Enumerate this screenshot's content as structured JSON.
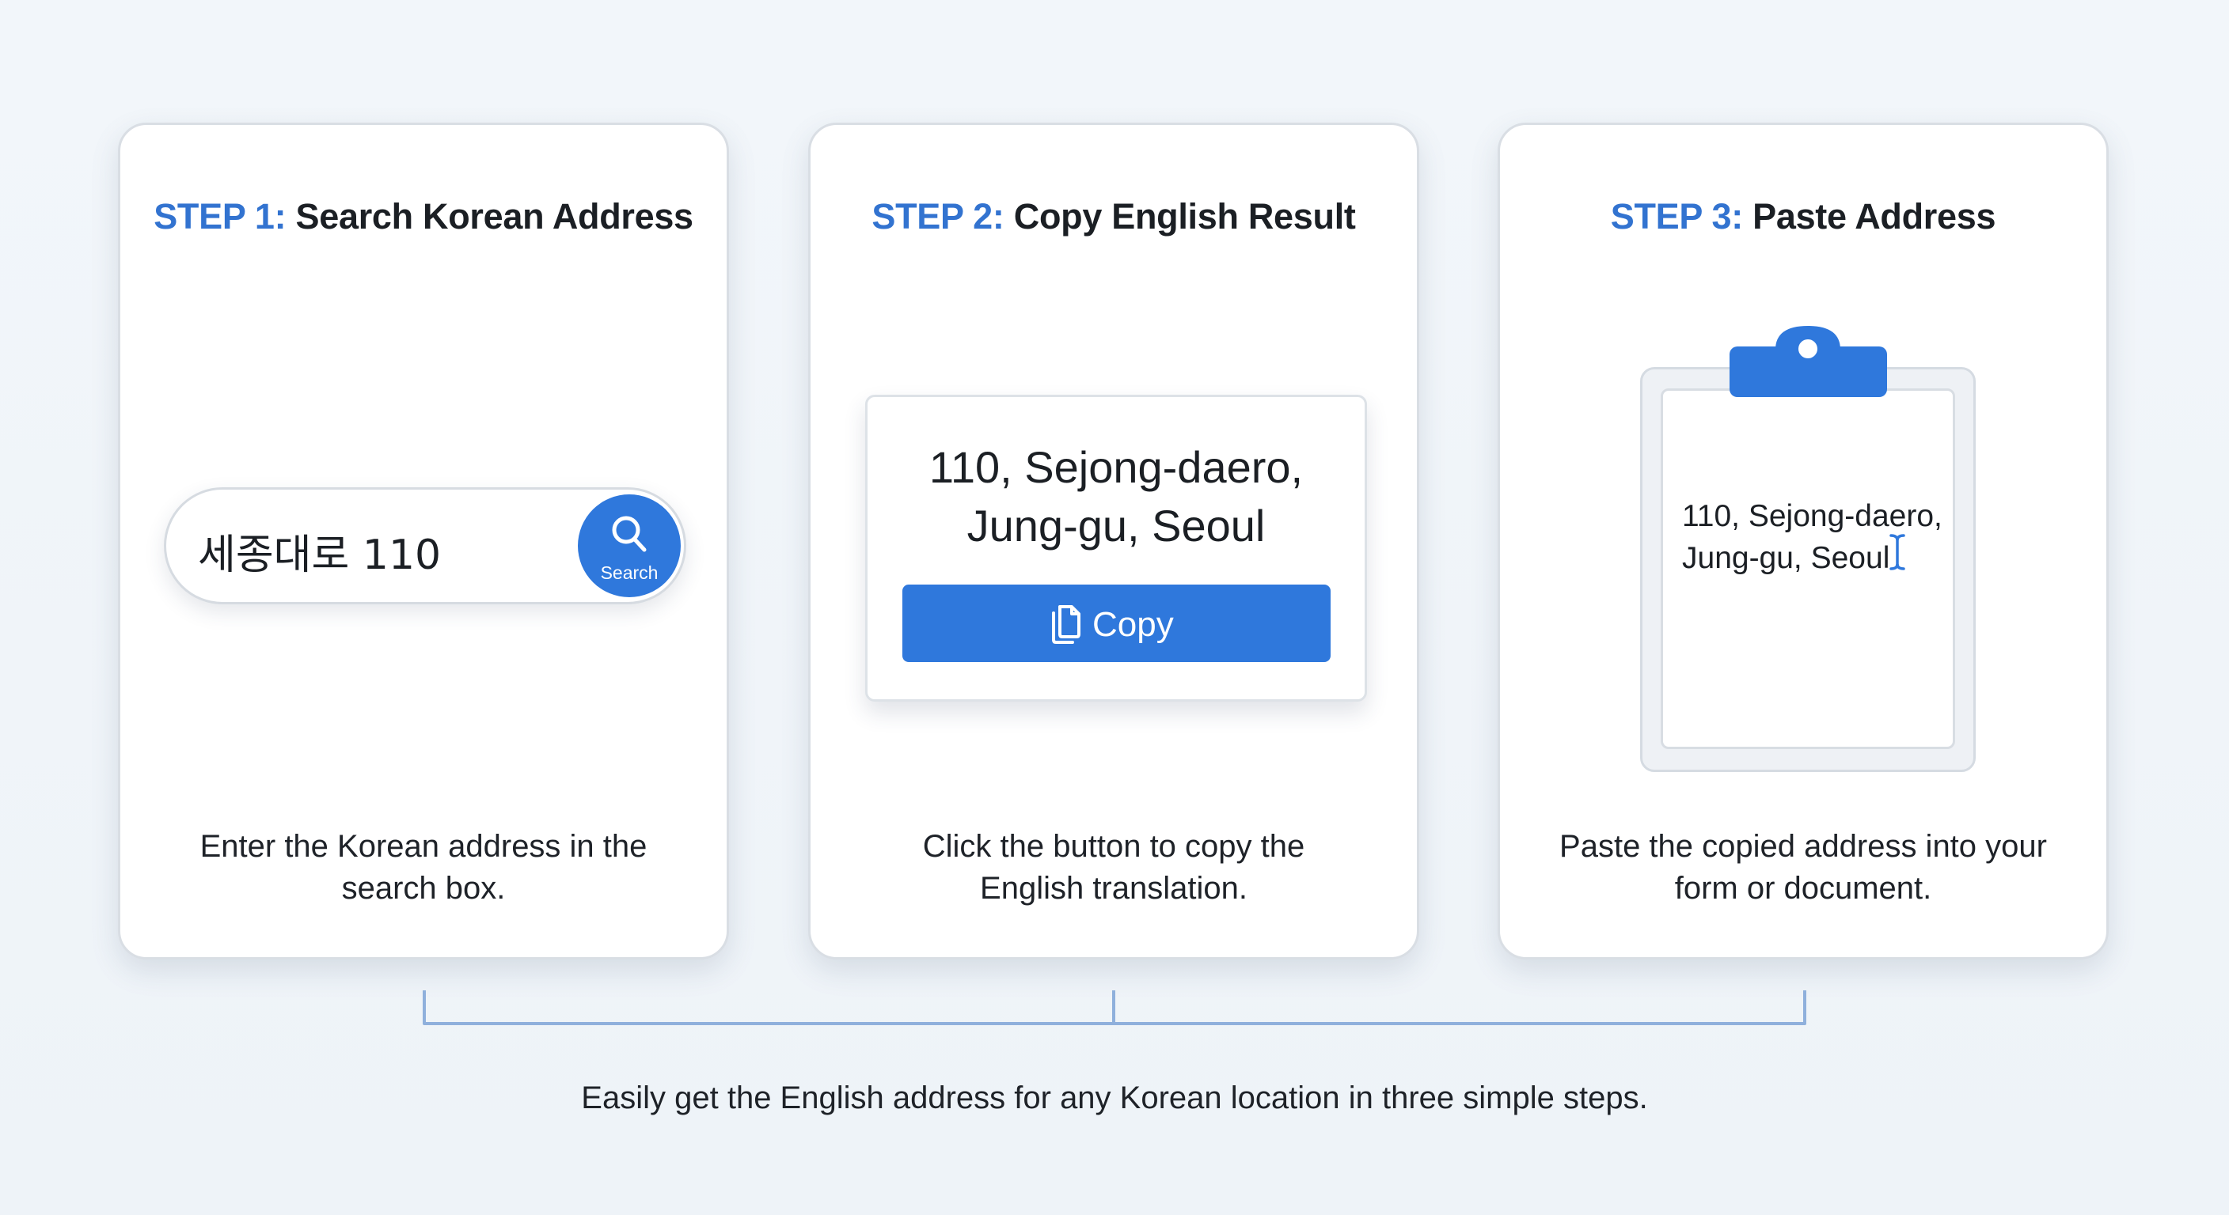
{
  "steps": [
    {
      "number": "STEP 1:",
      "title": "Search Korean Address",
      "description_lines": [
        "Enter the Korean address in the",
        "search box."
      ],
      "search": {
        "value": "세종대로 110",
        "button_label": "Search"
      }
    },
    {
      "number": "STEP 2:",
      "title": "Copy English Result",
      "description_lines": [
        "Click the button to copy the",
        "English translation."
      ],
      "result": {
        "lines": [
          "110, Sejong-daero,",
          "Jung-gu, Seoul"
        ],
        "button_label": "Copy"
      }
    },
    {
      "number": "STEP 3:",
      "title": "Paste Address",
      "description_lines": [
        "Paste the copied address into your",
        "form or document."
      ],
      "pasted": {
        "lines": [
          "110, Sejong-daero,",
          "Jung-gu, Seoul"
        ]
      }
    }
  ],
  "caption": "Easily get the English address for any Korean location in three simple steps.",
  "colors": {
    "accent": "#2f78dc",
    "step_label": "#3273d0",
    "bracket": "#8fb0dc",
    "background": "#f0f4f8"
  },
  "icons": {
    "search_button": "search-icon",
    "copy_button": "copy-icon",
    "clipboard": "clipboard-icon",
    "cursor": "text-cursor-icon"
  }
}
